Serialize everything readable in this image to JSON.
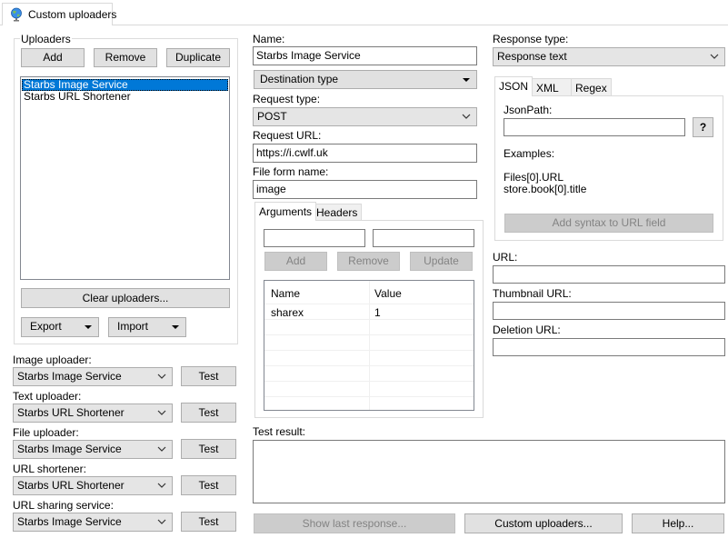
{
  "window_tab": {
    "label": "Custom uploaders",
    "icon": "globe-icon"
  },
  "uploaders": {
    "group_label": "Uploaders",
    "add_label": "Add",
    "remove_label": "Remove",
    "duplicate_label": "Duplicate",
    "items": [
      "Starbs Image Service",
      "Starbs URL Shortener"
    ],
    "selected_index": 0,
    "clear_label": "Clear uploaders...",
    "export_label": "Export",
    "import_label": "Import"
  },
  "destinations": {
    "image_label": "Image uploader:",
    "image_value": "Starbs Image Service",
    "text_label": "Text uploader:",
    "text_value": "Starbs URL Shortener",
    "file_label": "File uploader:",
    "file_value": "Starbs Image Service",
    "shortener_label": "URL shortener:",
    "shortener_value": "Starbs URL Shortener",
    "sharing_label": "URL sharing service:",
    "sharing_value": "Starbs Image Service",
    "test_label": "Test"
  },
  "request": {
    "name_label": "Name:",
    "name_value": "Starbs Image Service",
    "destination_type": "Destination type",
    "request_type_label": "Request type:",
    "request_type_value": "POST",
    "request_url_label": "Request URL:",
    "request_url_value": "https://i.cwlf.uk",
    "file_form_label": "File form name:",
    "file_form_value": "image",
    "tabs": [
      "Arguments",
      "Headers"
    ],
    "add_label": "Add",
    "remove_label": "Remove",
    "update_label": "Update",
    "columns": [
      "Name",
      "Value"
    ],
    "rows": [
      [
        "sharex",
        "1"
      ]
    ]
  },
  "response": {
    "type_label": "Response type:",
    "type_value": "Response text",
    "tabs": [
      "JSON",
      "XML",
      "Regex"
    ],
    "jsonpath_label": "JsonPath:",
    "help_label": "?",
    "examples_label": "Examples:",
    "example_1": "Files[0].URL",
    "example_2": "store.book[0].title",
    "add_syntax_label": "Add syntax to URL field",
    "url_label": "URL:",
    "thumbnail_label": "Thumbnail URL:",
    "deletion_label": "Deletion URL:"
  },
  "test": {
    "result_label": "Test result:",
    "show_last_label": "Show last response...",
    "custom_uploaders_label": "Custom uploaders...",
    "help_label": "Help..."
  }
}
